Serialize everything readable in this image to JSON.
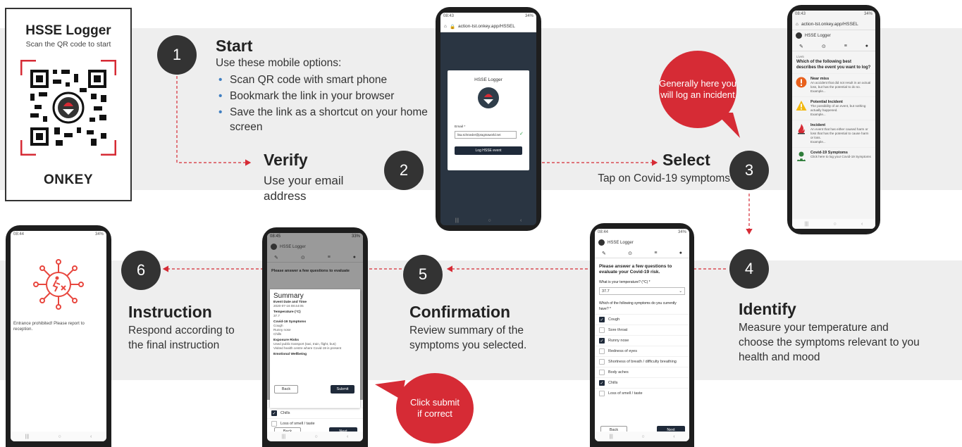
{
  "qr_card": {
    "title": "HSSE Logger",
    "subtitle": "Scan the QR code to start",
    "logo": "ONKEY"
  },
  "steps": [
    {
      "number": "1",
      "heading": "Start",
      "text": "Use these mobile options:",
      "bullets": [
        "Scan QR code with smart phone",
        "Bookmark the link in your browser",
        "Save the link as a shortcut on your home screen"
      ]
    },
    {
      "number": "2",
      "heading": "Verify",
      "text": "Use your email address"
    },
    {
      "number": "3",
      "heading": "Select",
      "text": "Tap on Covid-19 symptoms"
    },
    {
      "number": "4",
      "heading": "Identify",
      "text": "Measure your temperature and choose the symptoms relevant to you health and mood"
    },
    {
      "number": "5",
      "heading": "Confirmation",
      "text": "Review summary of the symptoms you selected."
    },
    {
      "number": "6",
      "heading": "Instruction",
      "text": "Respond according to the final instruction"
    }
  ],
  "bubbles": {
    "select_note": "Generally here you will log an incident",
    "submit_note": "Click submit if correct"
  },
  "phone_verify": {
    "status_left": "08:43",
    "status_right": "34%",
    "url": "action-tst.onkey.app/HSSEL",
    "app_title": "HSSE Logger",
    "email_label": "Email *",
    "email_value": "lisa.schroeder@pragmaworld.net",
    "button": "Log HSSE event"
  },
  "phone_select": {
    "status_left": "08:43",
    "status_right": "34%",
    "url": "action-tst.onkey.app/HSSEL",
    "app_title": "HSSE Logger",
    "crumb": "Live5",
    "question": "Which of the following best describes the event you want to log?",
    "options": [
      {
        "icon": "warning-circle-icon",
        "color": "#e8601c",
        "title": "Near miss",
        "desc": "An accident that did not result in an actual loss, but has the potential to do so.",
        "example": "Example..."
      },
      {
        "icon": "warning-triangle-icon",
        "color": "#f2b80f",
        "title": "Potential Incident",
        "desc": "The possibility of an event, but nothing actually happened.",
        "example": "Example..."
      },
      {
        "icon": "flame-icon",
        "color": "#d62b35",
        "title": "Incident",
        "desc": "An event that has either caused harm or loss that has the potential to cause harm or loss.",
        "example": "Example..."
      },
      {
        "icon": "covid-person-icon",
        "color": "#2f7d3a",
        "title": "Covid-19 Symptoms",
        "desc": "Click here to log your Covid-19 Symptoms",
        "example": ""
      }
    ]
  },
  "phone_identify": {
    "status_left": "08:44",
    "status_right": "34%",
    "app_title": "HSSE Logger",
    "intro": "Please answer a few questions to evaluate your Covid-19 risk.",
    "temp_label": "What is your temperature? (°C) *",
    "temp_value": "37.7",
    "symptoms_label": "Which of the following symptoms do you currently have? *",
    "symptoms": [
      {
        "label": "Cough",
        "checked": true
      },
      {
        "label": "Sore throat",
        "checked": false
      },
      {
        "label": "Runny nose",
        "checked": true
      },
      {
        "label": "Redness of eyes",
        "checked": false
      },
      {
        "label": "Shortness of breath / difficulty breathing",
        "checked": false
      },
      {
        "label": "Body aches",
        "checked": false
      },
      {
        "label": "Chills",
        "checked": true
      },
      {
        "label": "Loss of smell / taste",
        "checked": false
      }
    ],
    "back": "Back",
    "next": "Next"
  },
  "phone_confirm": {
    "status_left": "08:45",
    "status_right": "33%",
    "app_title": "HSSE Logger",
    "intro": "Please answer a few questions to evaluate",
    "summary_title": "Summary",
    "sections": [
      {
        "label": "Event Date and Time",
        "value": "2020-07-16 08:44:05"
      },
      {
        "label": "Temperature (°C)",
        "value": "37.7"
      },
      {
        "label": "Covid-19 Symptoms",
        "value": "Cough\nRunny nose\nChills"
      },
      {
        "label": "Exposure Risks",
        "value": "Used public transport (taxi, train, flight, bus)\nVisited health centre where Covid-19 is present"
      },
      {
        "label": "Emotional Wellbeing",
        "value": ""
      }
    ],
    "back": "Back",
    "submit": "Submit",
    "under_rows": [
      {
        "label": "Chills",
        "checked": true
      },
      {
        "label": "Loss of smell / taste",
        "checked": false
      }
    ],
    "under_back": "Back",
    "under_next": "Next"
  },
  "phone_instruction": {
    "status_left": "08:44",
    "status_right": "34%",
    "message": "Entrance prohibited! Please report to reception."
  }
}
